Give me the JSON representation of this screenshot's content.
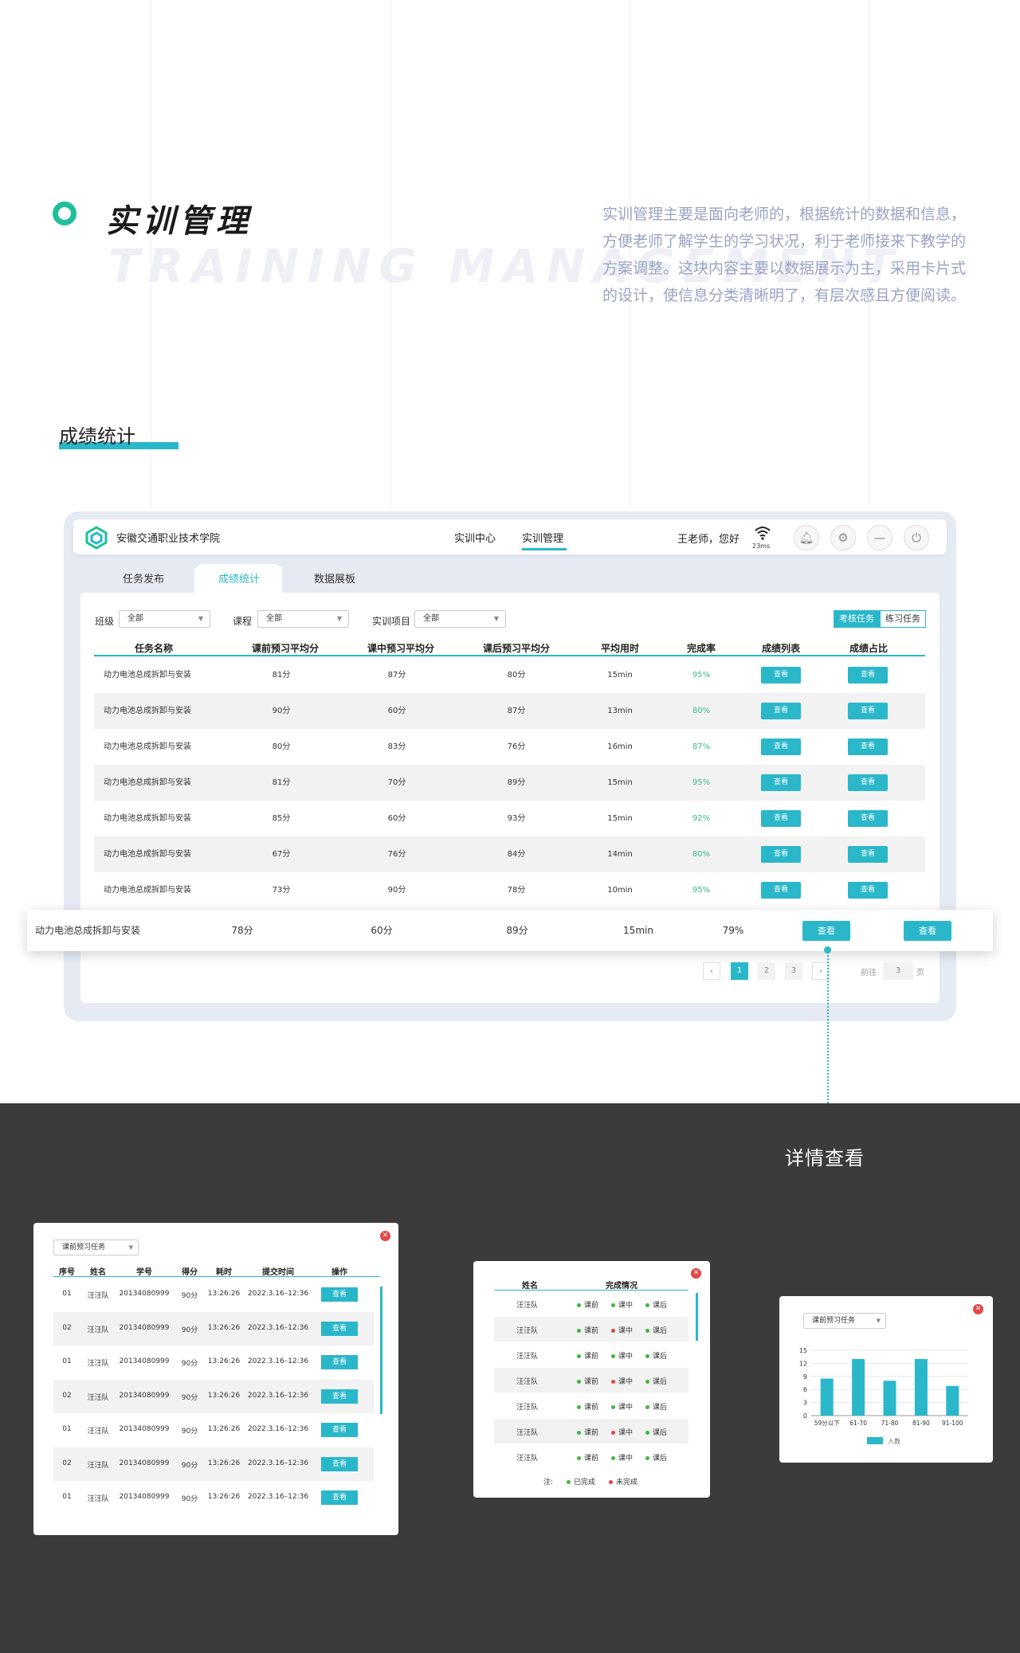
{
  "header": {
    "title_cn": "实训管理",
    "title_en": "TRAINING MANAGEMENT",
    "intro": "实训管理主要是面向老师的，根据统计的数据和信息，方便老师了解学生的学习状况，利于老师接来下教学的方案调整。这块内容主要以数据展示为主，采用卡片式的设计，使信息分类清晰明了，有层次感且方便阅读。",
    "section_title": "成绩统计"
  },
  "app": {
    "school": "安徽交通职业技术学院",
    "nav": [
      "实训中心",
      "实训管理"
    ],
    "active_nav": "实训管理",
    "greeting": "王老师，您好",
    "latency": "23ms",
    "tabs": [
      "任务发布",
      "成绩统计",
      "数据展板"
    ],
    "active_tab": "成绩统计",
    "filters": {
      "class_label": "班级",
      "class_value": "全部",
      "course_label": "课程",
      "course_value": "全部",
      "project_label": "实训项目",
      "project_value": "全部"
    },
    "toggle": [
      "考核任务",
      "练习任务"
    ],
    "columns": [
      "任务名称",
      "课前预习平均分",
      "课中预习平均分",
      "课后预习平均分",
      "平均用时",
      "完成率",
      "成绩列表",
      "成绩占比"
    ],
    "view_label": "查看",
    "rows": [
      {
        "name": "动力电池总成拆卸与安装",
        "pre": "81分",
        "mid": "87分",
        "post": "80分",
        "time": "15min",
        "rate": "95%"
      },
      {
        "name": "动力电池总成拆卸与安装",
        "pre": "90分",
        "mid": "60分",
        "post": "87分",
        "time": "13min",
        "rate": "80%"
      },
      {
        "name": "动力电池总成拆卸与安装",
        "pre": "80分",
        "mid": "83分",
        "post": "76分",
        "time": "16min",
        "rate": "87%"
      },
      {
        "name": "动力电池总成拆卸与安装",
        "pre": "81分",
        "mid": "70分",
        "post": "89分",
        "time": "15min",
        "rate": "95%"
      },
      {
        "name": "动力电池总成拆卸与安装",
        "pre": "85分",
        "mid": "60分",
        "post": "93分",
        "time": "15min",
        "rate": "92%"
      },
      {
        "name": "动力电池总成拆卸与安装",
        "pre": "67分",
        "mid": "76分",
        "post": "84分",
        "time": "14min",
        "rate": "80%"
      },
      {
        "name": "动力电池总成拆卸与安装",
        "pre": "73分",
        "mid": "90分",
        "post": "78分",
        "time": "10min",
        "rate": "95%"
      }
    ],
    "highlight_row": {
      "name": "动力电池总成拆卸与安装",
      "pre": "78分",
      "mid": "60分",
      "post": "89分",
      "time": "15min",
      "rate": "79%"
    },
    "pagination": {
      "pages": [
        "1",
        "2",
        "3"
      ],
      "current": "1",
      "goto_label": "前往",
      "goto_value": "3",
      "page_suffix": "页"
    }
  },
  "detail": {
    "title": "详情查看",
    "card1": {
      "select": "课前预习任务",
      "columns": [
        "序号",
        "姓名",
        "学号",
        "得分",
        "耗时",
        "提交时间",
        "操作"
      ],
      "rows": [
        [
          "01",
          "汪汪队",
          "20134080999",
          "90分",
          "13:26:26",
          "2022.3.16–12:36"
        ],
        [
          "02",
          "汪汪队",
          "20134080999",
          "90分",
          "13:26:26",
          "2022.3.16–12:36"
        ],
        [
          "01",
          "汪汪队",
          "20134080999",
          "90分",
          "13:26:26",
          "2022.3.16–12:36"
        ],
        [
          "02",
          "汪汪队",
          "20134080999",
          "90分",
          "13:26:26",
          "2022.3.16–12:36"
        ],
        [
          "01",
          "汪汪队",
          "20134080999",
          "90分",
          "13:26:26",
          "2022.3.16–12:36"
        ],
        [
          "02",
          "汪汪队",
          "20134080999",
          "90分",
          "13:26:26",
          "2022.3.16–12:36"
        ],
        [
          "01",
          "汪汪队",
          "20134080999",
          "90分",
          "13:26:26",
          "2022.3.16–12:36"
        ]
      ],
      "action": "查看"
    },
    "card2": {
      "columns": [
        "姓名",
        "完成情况"
      ],
      "stages": [
        "课前",
        "课中",
        "课后"
      ],
      "rows": [
        {
          "name": "汪汪队",
          "status": [
            "done",
            "done",
            "done"
          ]
        },
        {
          "name": "汪汪队",
          "status": [
            "done",
            "todo",
            "done"
          ]
        },
        {
          "name": "汪汪队",
          "status": [
            "done",
            "done",
            "done"
          ]
        },
        {
          "name": "汪汪队",
          "status": [
            "done",
            "todo",
            "done"
          ]
        },
        {
          "name": "汪汪队",
          "status": [
            "done",
            "done",
            "done"
          ]
        },
        {
          "name": "汪汪队",
          "status": [
            "done",
            "todo",
            "done"
          ]
        },
        {
          "name": "汪汪队",
          "status": [
            "done",
            "done",
            "done"
          ]
        }
      ],
      "note_label": "注:",
      "legend_done": "已完成",
      "legend_todo": "未完成",
      "colors": {
        "done": "#3cb93c",
        "todo": "#e64545"
      }
    },
    "card3": {
      "select": "课前预习任务"
    }
  },
  "chart_data": {
    "type": "bar",
    "categories": [
      "59分以下",
      "61-70",
      "71-80",
      "81-90",
      "91-100"
    ],
    "series": [
      {
        "name": "人数",
        "values": [
          8.5,
          13,
          8,
          13,
          6.8
        ]
      }
    ],
    "ylim": [
      0,
      15
    ],
    "yticks": [
      0,
      3,
      6,
      9,
      12,
      15
    ],
    "legend": "bottom-center",
    "color": "#2ab7c9"
  }
}
